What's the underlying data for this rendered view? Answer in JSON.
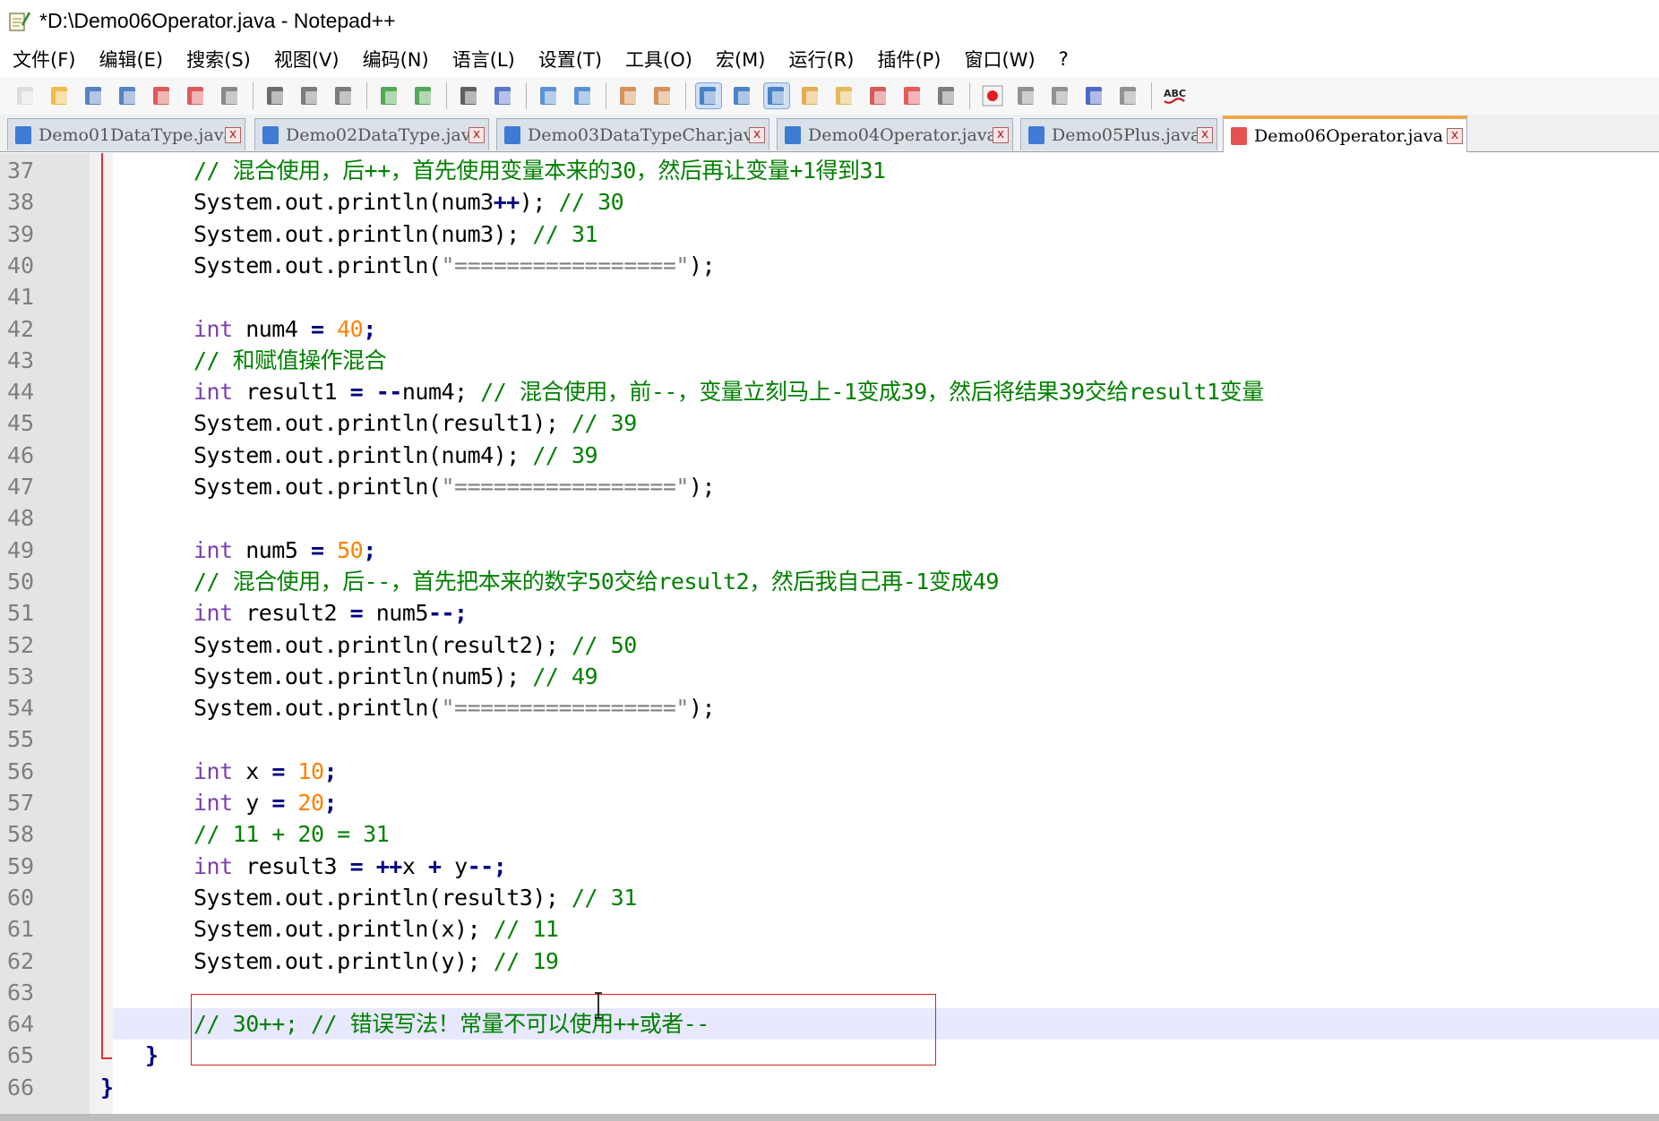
{
  "window": {
    "title": "*D:\\Demo06Operator.java - Notepad++"
  },
  "menu": [
    "文件(F)",
    "编辑(E)",
    "搜索(S)",
    "视图(V)",
    "编码(N)",
    "语言(L)",
    "设置(T)",
    "工具(O)",
    "宏(M)",
    "运行(R)",
    "插件(P)",
    "窗口(W)",
    "?"
  ],
  "toolbar": {
    "icons": [
      "new-file-icon",
      "open-file-icon",
      "save-icon",
      "save-all-icon",
      "close-icon",
      "close-all-icon",
      "print-icon",
      "cut-icon",
      "copy-icon",
      "paste-icon",
      "undo-icon",
      "redo-icon",
      "find-icon",
      "replace-icon",
      "zoom-in-icon",
      "zoom-out-icon",
      "sync-v-icon",
      "sync-h-icon",
      "word-wrap-icon",
      "show-all-chars-icon",
      "indent-guide-icon",
      "user-lang-icon",
      "doc-map-icon",
      "function-list-icon",
      "folder-workspace-icon",
      "monitor-icon",
      "record-macro-icon",
      "stop-macro-icon",
      "play-macro-icon",
      "run-multiple-macro-icon",
      "save-macro-icon",
      "spellcheck-icon"
    ],
    "spell_label": "ABC"
  },
  "tabs": [
    {
      "label": "Demo01DataType.java",
      "active": false
    },
    {
      "label": "Demo02DataType.java",
      "active": false
    },
    {
      "label": "Demo03DataTypeChar.java",
      "active": false
    },
    {
      "label": "Demo04Operator.java",
      "active": false
    },
    {
      "label": "Demo05Plus.java",
      "active": false
    },
    {
      "label": "Demo06Operator.java",
      "active": true
    }
  ],
  "tab_close_glyph": "x",
  "editor": {
    "current_line": 64,
    "lines": [
      {
        "n": "37",
        "code": [
          [
            "cm",
            "// 混合使用，后++，首先使用变量本来的30，然后再让变量+1得到31"
          ]
        ]
      },
      {
        "n": "38",
        "code": [
          [
            "id",
            "System.out.println(num3"
          ],
          [
            "op",
            "++"
          ],
          [
            "id",
            ");"
          ],
          [
            "cm",
            " // 30"
          ]
        ]
      },
      {
        "n": "39",
        "code": [
          [
            "id",
            "System.out.println(num3);"
          ],
          [
            "cm",
            " // 31"
          ]
        ]
      },
      {
        "n": "40",
        "code": [
          [
            "id",
            "System.out.println("
          ],
          [
            "st",
            "\"=================\""
          ],
          [
            "id",
            ");"
          ]
        ]
      },
      {
        "n": "41",
        "code": []
      },
      {
        "n": "42",
        "code": [
          [
            "kw",
            "int"
          ],
          [
            "id",
            " num4 "
          ],
          [
            "op",
            "="
          ],
          [
            "nm",
            " 40"
          ],
          [
            "op",
            ";"
          ]
        ]
      },
      {
        "n": "43",
        "code": [
          [
            "cm",
            "// 和赋值操作混合"
          ]
        ]
      },
      {
        "n": "44",
        "code": [
          [
            "kw",
            "int"
          ],
          [
            "id",
            " result1 "
          ],
          [
            "op",
            "="
          ],
          [
            "op",
            " --"
          ],
          [
            "id",
            "num4;"
          ],
          [
            "cm",
            " // 混合使用，前--，变量立刻马上-1变成39，然后将结果39交给result1变量"
          ]
        ]
      },
      {
        "n": "45",
        "code": [
          [
            "id",
            "System.out.println(result1);"
          ],
          [
            "cm",
            " // 39"
          ]
        ]
      },
      {
        "n": "46",
        "code": [
          [
            "id",
            "System.out.println(num4);"
          ],
          [
            "cm",
            " // 39"
          ]
        ]
      },
      {
        "n": "47",
        "code": [
          [
            "id",
            "System.out.println("
          ],
          [
            "st",
            "\"=================\""
          ],
          [
            "id",
            ");"
          ]
        ]
      },
      {
        "n": "48",
        "code": []
      },
      {
        "n": "49",
        "code": [
          [
            "kw",
            "int"
          ],
          [
            "id",
            " num5 "
          ],
          [
            "op",
            "="
          ],
          [
            "nm",
            " 50"
          ],
          [
            "op",
            ";"
          ]
        ]
      },
      {
        "n": "50",
        "code": [
          [
            "cm",
            "// 混合使用，后--，首先把本来的数字50交给result2，然后我自己再-1变成49"
          ]
        ]
      },
      {
        "n": "51",
        "code": [
          [
            "kw",
            "int"
          ],
          [
            "id",
            " result2 "
          ],
          [
            "op",
            "="
          ],
          [
            "id",
            " num5"
          ],
          [
            "op",
            "--;"
          ]
        ]
      },
      {
        "n": "52",
        "code": [
          [
            "id",
            "System.out.println(result2);"
          ],
          [
            "cm",
            " // 50"
          ]
        ]
      },
      {
        "n": "53",
        "code": [
          [
            "id",
            "System.out.println(num5);"
          ],
          [
            "cm",
            " // 49"
          ]
        ]
      },
      {
        "n": "54",
        "code": [
          [
            "id",
            "System.out.println("
          ],
          [
            "st",
            "\"=================\""
          ],
          [
            "id",
            ");"
          ]
        ]
      },
      {
        "n": "55",
        "code": []
      },
      {
        "n": "56",
        "code": [
          [
            "kw",
            "int"
          ],
          [
            "id",
            " x "
          ],
          [
            "op",
            "="
          ],
          [
            "nm",
            " 10"
          ],
          [
            "op",
            ";"
          ]
        ]
      },
      {
        "n": "57",
        "code": [
          [
            "kw",
            "int"
          ],
          [
            "id",
            " y "
          ],
          [
            "op",
            "="
          ],
          [
            "nm",
            " 20"
          ],
          [
            "op",
            ";"
          ]
        ]
      },
      {
        "n": "58",
        "code": [
          [
            "cm",
            "// 11 + 20 = 31"
          ]
        ]
      },
      {
        "n": "59",
        "code": [
          [
            "kw",
            "int"
          ],
          [
            "id",
            " result3 "
          ],
          [
            "op",
            "="
          ],
          [
            "op",
            " ++"
          ],
          [
            "id",
            "x "
          ],
          [
            "op",
            "+"
          ],
          [
            "id",
            " y"
          ],
          [
            "op",
            "--;"
          ]
        ]
      },
      {
        "n": "60",
        "code": [
          [
            "id",
            "System.out.println(result3);"
          ],
          [
            "cm",
            " // 31"
          ]
        ]
      },
      {
        "n": "61",
        "code": [
          [
            "id",
            "System.out.println(x);"
          ],
          [
            "cm",
            " // 11"
          ]
        ]
      },
      {
        "n": "62",
        "code": [
          [
            "id",
            "System.out.println(y);"
          ],
          [
            "cm",
            " // 19"
          ]
        ]
      },
      {
        "n": "63",
        "code": []
      },
      {
        "n": "64",
        "code": [
          [
            "cm",
            "// 30++; // 错误写法！常量不可以使用++或者--"
          ]
        ]
      },
      {
        "n": "65",
        "code": [
          [
            "op",
            "}"
          ]
        ]
      },
      {
        "n": "66",
        "code": [
          [
            "op",
            "}"
          ]
        ]
      }
    ]
  },
  "colors": {
    "keyword": "#7b3fb0",
    "comment": "#008000",
    "number": "#ff8000",
    "string": "#808080",
    "operator": "#000080",
    "current_line_bg": "#e8e8ff",
    "annotation_box": "#e02020",
    "active_tab_accent": "#f3a84a"
  }
}
